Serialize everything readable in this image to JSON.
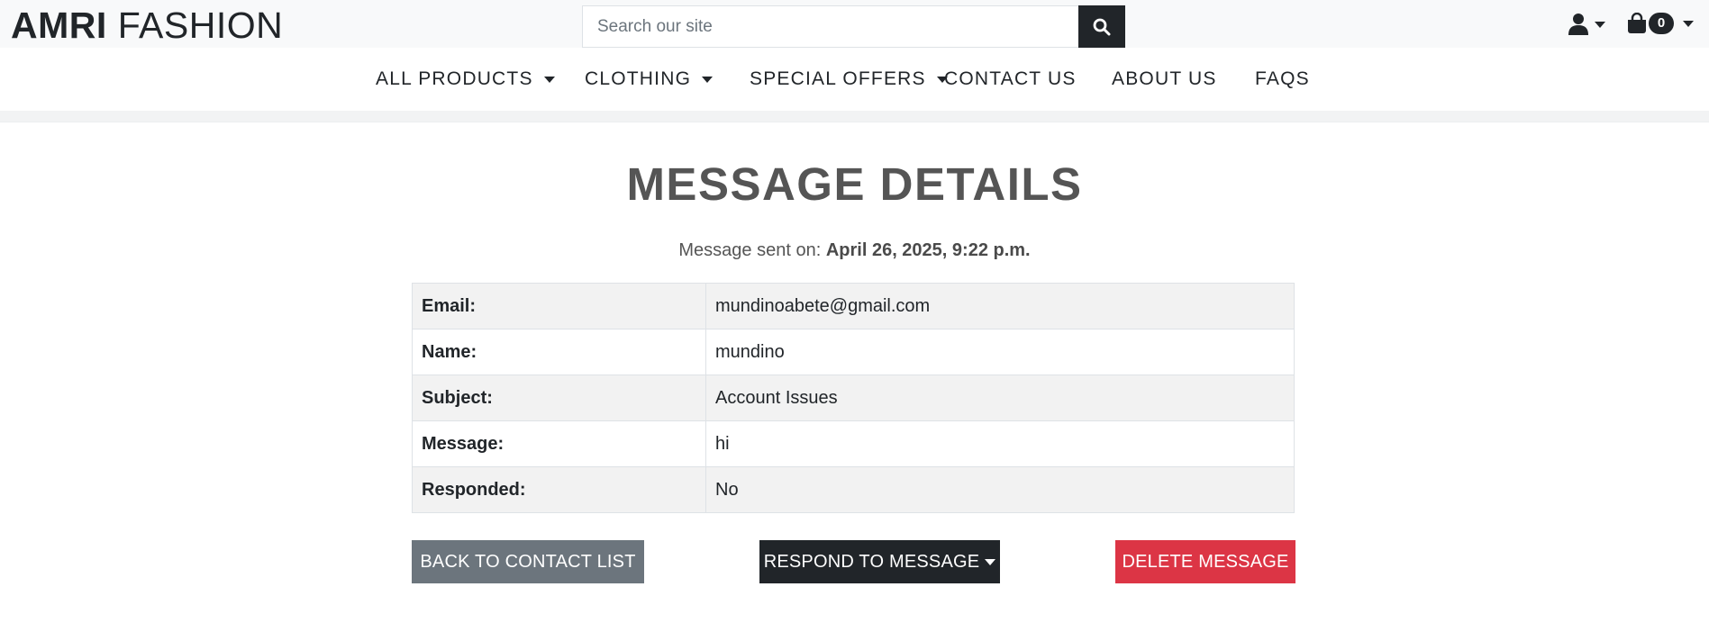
{
  "brand": {
    "part1": "AMRI",
    "part2": "FASHION"
  },
  "search": {
    "placeholder": "Search our site",
    "icon": "search-icon"
  },
  "account": {
    "icon": "user-icon"
  },
  "cart": {
    "icon": "shopping-bag-icon",
    "count": "0"
  },
  "nav": {
    "items": [
      {
        "label": "ALL PRODUCTS",
        "dropdown": true
      },
      {
        "label": "CLOTHING",
        "dropdown": true
      },
      {
        "label": "SPECIAL OFFERS",
        "dropdown": true
      },
      {
        "label": "CONTACT US",
        "dropdown": false
      },
      {
        "label": "ABOUT US",
        "dropdown": false
      },
      {
        "label": "FAQS",
        "dropdown": false
      }
    ]
  },
  "page": {
    "title": "MESSAGE DETAILS",
    "sent_label": "Message sent on:",
    "sent_value": "April 26, 2025, 9:22 p.m."
  },
  "details": [
    {
      "key": "Email:",
      "value": "mundinoabete@gmail.com"
    },
    {
      "key": "Name:",
      "value": "mundino"
    },
    {
      "key": "Subject:",
      "value": "Account Issues"
    },
    {
      "key": "Message:",
      "value": "hi"
    },
    {
      "key": "Responded:",
      "value": "No"
    }
  ],
  "actions": {
    "back": "BACK TO CONTACT LIST",
    "respond": "RESPOND TO MESSAGE",
    "delete": "DELETE MESSAGE"
  },
  "colors": {
    "dark": "#212529",
    "secondary": "#6c757d",
    "danger": "#dc3545",
    "title": "#555555"
  }
}
